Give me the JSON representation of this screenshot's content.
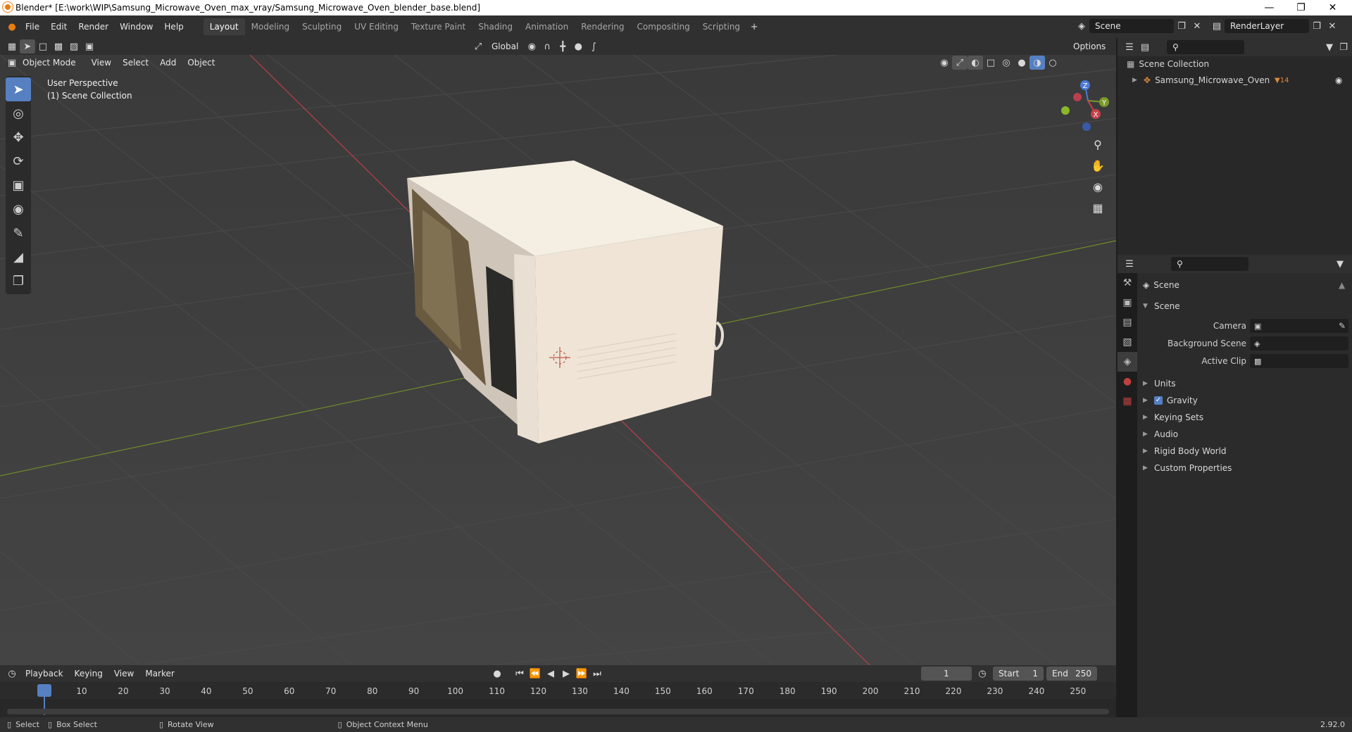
{
  "window": {
    "title": "Blender* [E:\\work\\WIP\\Samsung_Microwave_Oven_max_vray/Samsung_Microwave_Oven_blender_base.blend]"
  },
  "menu": [
    "File",
    "Edit",
    "Render",
    "Window",
    "Help"
  ],
  "workspaces": [
    "Layout",
    "Modeling",
    "Sculpting",
    "UV Editing",
    "Texture Paint",
    "Shading",
    "Animation",
    "Rendering",
    "Compositing",
    "Scripting"
  ],
  "active_workspace": "Layout",
  "scene_field": "Scene",
  "render_layer_field": "RenderLayer",
  "viewport": {
    "mode": "Object Mode",
    "menus": [
      "View",
      "Select",
      "Add",
      "Object"
    ],
    "orientation": "Global",
    "options_label": "Options",
    "overlay_line1": "User Perspective",
    "overlay_line2": "(1) Scene Collection",
    "gizmo_labels": {
      "z": "Z",
      "y": "Y",
      "x": "X"
    }
  },
  "outliner": {
    "root": "Scene Collection",
    "items": [
      {
        "name": "Samsung_Microwave_Oven",
        "badge": "14"
      }
    ]
  },
  "properties": {
    "context": "Scene",
    "section": "Scene",
    "fields": [
      {
        "label": "Camera"
      },
      {
        "label": "Background Scene"
      },
      {
        "label": "Active Clip"
      }
    ],
    "panels": [
      "Units",
      "Gravity",
      "Keying Sets",
      "Audio",
      "Rigid Body World",
      "Custom Properties"
    ],
    "gravity_checked": true
  },
  "timeline": {
    "menus": [
      "Playback",
      "Keying",
      "View",
      "Marker"
    ],
    "current_frame": "1",
    "start_label": "Start",
    "start": "1",
    "end_label": "End",
    "end": "250",
    "ticks": [
      "1",
      "10",
      "20",
      "30",
      "40",
      "50",
      "60",
      "70",
      "80",
      "90",
      "100",
      "110",
      "120",
      "130",
      "140",
      "150",
      "160",
      "170",
      "180",
      "190",
      "200",
      "210",
      "220",
      "230",
      "240",
      "250"
    ]
  },
  "statusbar": {
    "select": "Select",
    "box_select": "Box Select",
    "rotate": "Rotate View",
    "context_menu": "Object Context Menu",
    "version": "2.92.0"
  },
  "colors": {
    "accent": "#5680c2",
    "x_axis": "#c8404a",
    "y_axis": "#7a9a2a",
    "z_axis": "#4a7ad8"
  }
}
